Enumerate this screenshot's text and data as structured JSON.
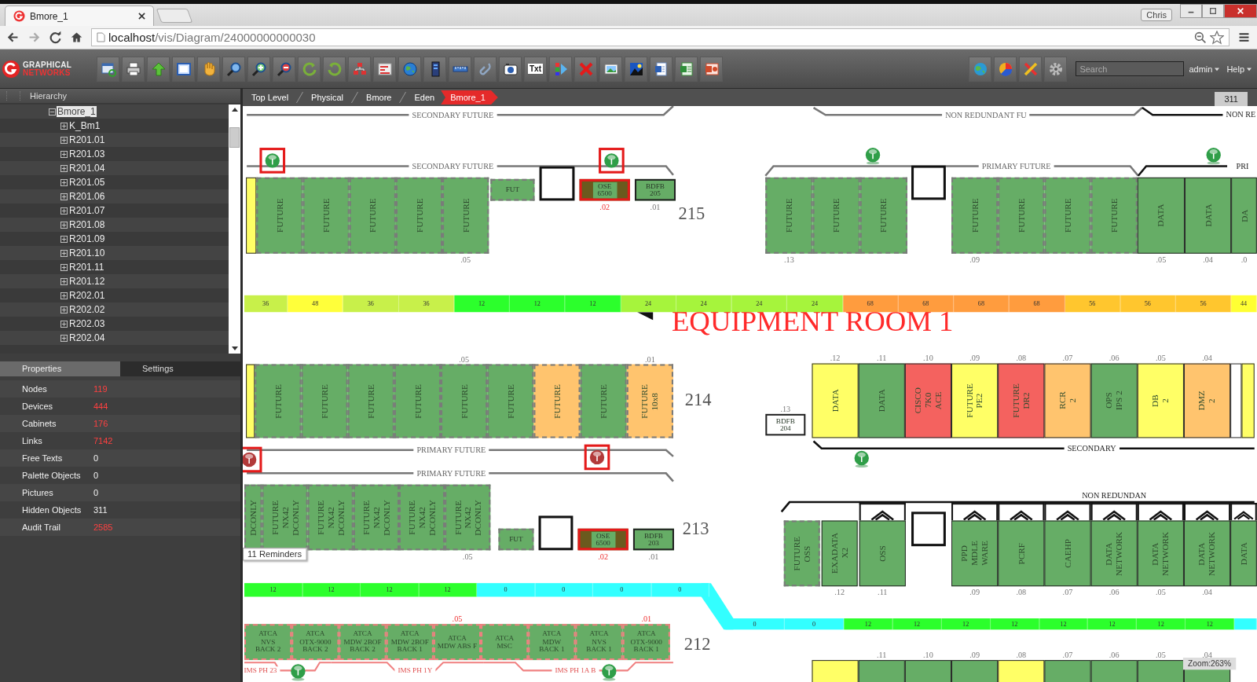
{
  "browser": {
    "tab_title": "Bmore_1",
    "profile": "Chris",
    "url_host": "localhost",
    "url_path": "/vis/Diagram/24000000000030"
  },
  "toolbar": {
    "logo_top": "GRAPHICAL",
    "logo_bottom": "NETWORKS",
    "text_tool": "Txt",
    "search": {
      "placeholder": "Search"
    },
    "menus": [
      "admin",
      "Help"
    ]
  },
  "hierarchy": {
    "title": "Hierarchy",
    "tree": [
      {
        "label": "Bmore_1",
        "expanded": true,
        "selected": true,
        "children": [
          {
            "label": "K_Bm1",
            "expanded": false,
            "selected": false
          },
          {
            "label": "R201.01",
            "expanded": false,
            "selected": false
          },
          {
            "label": "R201.03",
            "expanded": false,
            "selected": false
          },
          {
            "label": "R201.04",
            "expanded": false,
            "selected": false
          },
          {
            "label": "R201.05",
            "expanded": false,
            "selected": false
          },
          {
            "label": "R201.06",
            "expanded": false,
            "selected": false
          },
          {
            "label": "R201.07",
            "expanded": false,
            "selected": false
          },
          {
            "label": "R201.08",
            "expanded": false,
            "selected": false
          },
          {
            "label": "R201.09",
            "expanded": false,
            "selected": false
          },
          {
            "label": "R201.10",
            "expanded": false,
            "selected": false
          },
          {
            "label": "R201.11",
            "expanded": false,
            "selected": false
          },
          {
            "label": "R201.12",
            "expanded": false,
            "selected": false
          },
          {
            "label": "R202.01",
            "expanded": false,
            "selected": false
          },
          {
            "label": "R202.02",
            "expanded": false,
            "selected": false
          },
          {
            "label": "R202.03",
            "expanded": false,
            "selected": false
          },
          {
            "label": "R202.04",
            "expanded": false,
            "selected": false
          }
        ]
      }
    ]
  },
  "properties": {
    "tabs": [
      {
        "label": "Properties",
        "selected": true
      },
      {
        "label": "Settings",
        "selected": false
      }
    ],
    "rows": [
      {
        "label": "Nodes",
        "value": "119",
        "alert": true
      },
      {
        "label": "Devices",
        "value": "444",
        "alert": true
      },
      {
        "label": "Cabinets",
        "value": "176",
        "alert": true
      },
      {
        "label": "Links",
        "value": "7142",
        "alert": true
      },
      {
        "label": "Free Texts",
        "value": "0",
        "alert": false
      },
      {
        "label": "Palette Objects",
        "value": "0",
        "alert": false
      },
      {
        "label": "Pictures",
        "value": "0",
        "alert": false
      },
      {
        "label": "Hidden Objects",
        "value": "311",
        "alert": false
      },
      {
        "label": "Audit Trail",
        "value": "2585",
        "alert": true
      }
    ]
  },
  "breadcrumb": [
    {
      "label": "Top Level",
      "selected": false
    },
    {
      "label": "Physical",
      "selected": false
    },
    {
      "label": "Bmore",
      "selected": false
    },
    {
      "label": "Eden",
      "selected": false
    },
    {
      "label": "Bmore_1",
      "selected": true
    }
  ],
  "hidden_badge": "311",
  "canvas": {
    "groups": [
      {
        "kind": "standard",
        "items": [
          {
            "kind": "cabinet",
            "color": "#ffff66",
            "planned": false
          },
          {
            "kind": "cabinet",
            "lines": [
              "FUTURE"
            ],
            "color": "#66ad66",
            "planned": true
          },
          {
            "kind": "cabinet",
            "lines": [
              "FUTURE"
            ],
            "color": "#66ad66",
            "planned": true
          },
          {
            "kind": "cabinet",
            "lines": [
              "FUTURE"
            ],
            "color": "#66ad66",
            "planned": true
          },
          {
            "kind": "cabinet",
            "lines": [
              "FUTURE"
            ],
            "color": "#66ad66",
            "planned": true
          },
          {
            "kind": "cabinet",
            "lines": [
              "FUTURE"
            ],
            "color": "#66ad66",
            "planned": true,
            "number": {
              "text": ".05",
              "alert": false
            }
          }
        ]
      },
      {
        "kind": "standard",
        "items": [
          {
            "kind": "device",
            "lines": [
              "FUT"
            ],
            "color": "#66ad66",
            "planned": true,
            "alert": false
          },
          {
            "kind": "slot"
          },
          {
            "kind": "device",
            "lines": [
              "OSE",
              "6500"
            ],
            "color": "#66ad66",
            "planned": false,
            "alert": true,
            "number": {
              "text": ".02",
              "alert": true
            }
          },
          {
            "kind": "device",
            "lines": [
              "BDFB",
              "205"
            ],
            "color": "#66ad66",
            "planned": false,
            "alert": false,
            "number": {
              "text": ".01",
              "alert": false
            }
          }
        ]
      },
      {
        "kind": "standard",
        "items": [
          {
            "kind": "cabinet",
            "lines": [
              "FUTURE"
            ],
            "color": "#66ad66",
            "planned": true,
            "number": {
              "text": ".13",
              "alert": false
            }
          },
          {
            "kind": "cabinet",
            "lines": [
              "FUTURE"
            ],
            "color": "#66ad66",
            "planned": true
          },
          {
            "kind": "cabinet",
            "lines": [
              "FUTURE"
            ],
            "color": "#66ad66",
            "planned": true
          }
        ]
      },
      {
        "kind": "standard",
        "items": [
          {
            "kind": "slot"
          }
        ]
      },
      {
        "kind": "standard",
        "items": [
          {
            "kind": "cabinet",
            "lines": [
              "FUTURE"
            ],
            "color": "#66ad66",
            "planned": true,
            "number": {
              "text": ".09",
              "alert": false
            }
          },
          {
            "kind": "cabinet",
            "lines": [
              "FUTURE"
            ],
            "color": "#66ad66",
            "planned": true
          },
          {
            "kind": "cabinet",
            "lines": [
              "FUTURE"
            ],
            "color": "#66ad66",
            "planned": true
          },
          {
            "kind": "cabinet",
            "lines": [
              "FUTURE"
            ],
            "color": "#66ad66",
            "planned": true
          },
          {
            "kind": "cabinet",
            "lines": [
              "DATA"
            ],
            "color": "#66ad66",
            "planned": false,
            "number": {
              "text": ".05",
              "alert": false
            }
          },
          {
            "kind": "cabinet",
            "lines": [
              "DATA"
            ],
            "color": "#66ad66",
            "planned": false,
            "number": {
              "text": ".04",
              "alert": false
            }
          },
          {
            "kind": "cabinet",
            "lines": [
              "DA"
            ],
            "color": "#66ad66",
            "planned": false,
            "number": {
              "text": ".0",
              "alert": false
            }
          }
        ]
      },
      {
        "kind": "standard",
        "items": [
          {
            "kind": "cabinet",
            "color": "#ffff66",
            "planned": false
          },
          {
            "kind": "cabinet",
            "lines": [
              "FUTURE"
            ],
            "color": "#66ad66",
            "planned": true
          },
          {
            "kind": "cabinet",
            "lines": [
              "FUTURE"
            ],
            "color": "#66ad66",
            "planned": true
          },
          {
            "kind": "cabinet",
            "lines": [
              "FUTURE"
            ],
            "color": "#66ad66",
            "planned": true
          },
          {
            "kind": "cabinet",
            "lines": [
              "FUTURE"
            ],
            "color": "#66ad66",
            "planned": true
          },
          {
            "kind": "cabinet",
            "lines": [
              "FUTURE"
            ],
            "color": "#66ad66",
            "planned": true,
            "number": {
              "text": ".05",
              "alert": false
            }
          },
          {
            "kind": "cabinet",
            "lines": [
              "FUTURE"
            ],
            "color": "#66ad66",
            "planned": true
          },
          {
            "kind": "cabinet",
            "lines": [
              "FUTURE"
            ],
            "color": "#ffc46e",
            "planned": true
          },
          {
            "kind": "cabinet",
            "lines": [
              "FUTURE"
            ],
            "color": "#66ad66",
            "planned": true
          },
          {
            "kind": "cabinet",
            "lines": [
              "FUTURE",
              "10x8"
            ],
            "color": "#ffc46e",
            "planned": true,
            "number": {
              "text": ".01",
              "alert": false
            }
          }
        ]
      },
      {
        "kind": "standard",
        "items": [
          {
            "kind": "device",
            "lines": [
              "BDFB",
              "204"
            ],
            "color": "#ffffff",
            "planned": false,
            "alert": false,
            "number": {
              "text": ".13",
              "alert": false
            }
          }
        ]
      },
      {
        "kind": "standard",
        "items": [
          {
            "kind": "cabinet",
            "lines": [
              "DATA"
            ],
            "color": "#ffff66",
            "planned": false,
            "number": {
              "text": ".12",
              "alert": false
            }
          },
          {
            "kind": "cabinet",
            "lines": [
              "DATA"
            ],
            "color": "#66ad66",
            "planned": false,
            "number": {
              "text": ".11",
              "alert": false
            }
          },
          {
            "kind": "cabinet",
            "lines": [
              "CISCO",
              "7K0",
              "ACE"
            ],
            "color": "#f4625f",
            "planned": false,
            "number": {
              "text": ".10",
              "alert": false
            }
          },
          {
            "kind": "cabinet",
            "lines": [
              "FUTURE",
              "PE2"
            ],
            "color": "#ffff66",
            "planned": false,
            "number": {
              "text": ".09",
              "alert": false
            }
          },
          {
            "kind": "cabinet",
            "lines": [
              "FUTURE",
              "DR2"
            ],
            "color": "#f4625f",
            "planned": false,
            "number": {
              "text": ".08",
              "alert": false
            }
          },
          {
            "kind": "cabinet",
            "lines": [
              "RCR",
              "2"
            ],
            "color": "#ffc46e",
            "planned": false,
            "number": {
              "text": ".07",
              "alert": false
            }
          },
          {
            "kind": "cabinet",
            "lines": [
              "OPS",
              "IPS 2"
            ],
            "color": "#66ad66",
            "planned": false,
            "number": {
              "text": ".06",
              "alert": false
            }
          },
          {
            "kind": "cabinet",
            "lines": [
              "DB",
              "2"
            ],
            "color": "#ffff66",
            "planned": false,
            "number": {
              "text": ".05",
              "alert": false
            }
          },
          {
            "kind": "cabinet",
            "lines": [
              "DMZ",
              "2"
            ],
            "color": "#ffc46e",
            "planned": false,
            "number": {
              "text": ".04",
              "alert": false
            }
          },
          {
            "kind": "cabinet",
            "color": "#ffffff",
            "planned": false
          },
          {
            "kind": "cabinet",
            "color": "#ffff66",
            "planned": false
          }
        ]
      },
      {
        "kind": "standard",
        "items": [
          {
            "kind": "cabinet",
            "lines": [
              "DCONLY"
            ],
            "color": "#66ad66",
            "planned": true
          },
          {
            "kind": "cabinet",
            "lines": [
              "FUTURE",
              "NX42",
              "DCONLY"
            ],
            "color": "#66ad66",
            "planned": true
          },
          {
            "kind": "cabinet",
            "lines": [
              "FUTURE",
              "NX42",
              "DCONLY"
            ],
            "color": "#66ad66",
            "planned": true
          },
          {
            "kind": "cabinet",
            "lines": [
              "FUTURE",
              "NX42",
              "DCONLY"
            ],
            "color": "#66ad66",
            "planned": true
          },
          {
            "kind": "cabinet",
            "lines": [
              "FUTURE",
              "NX42",
              "DCONLY"
            ],
            "color": "#66ad66",
            "planned": true
          },
          {
            "kind": "cabinet",
            "lines": [
              "FUTURE",
              "NX42",
              "DCONLY"
            ],
            "color": "#66ad66",
            "planned": true,
            "number": {
              "text": ".05",
              "alert": false
            }
          }
        ]
      },
      {
        "kind": "standard",
        "items": [
          {
            "kind": "device",
            "lines": [
              "FUT"
            ],
            "color": "#66ad66",
            "planned": true,
            "alert": false
          },
          {
            "kind": "slot"
          },
          {
            "kind": "device",
            "lines": [
              "OSE",
              "6500"
            ],
            "color": "#66ad66",
            "planned": false,
            "alert": true,
            "number": {
              "text": ".02",
              "alert": true
            }
          },
          {
            "kind": "device",
            "lines": [
              "BDFB",
              "203"
            ],
            "color": "#66ad66",
            "planned": false,
            "alert": false,
            "number": {
              "text": ".01",
              "alert": false
            }
          }
        ]
      },
      {
        "kind": "standard",
        "items": [
          {
            "kind": "cabinet",
            "lines": [
              "FUTURE",
              "OSS"
            ],
            "color": "#66ad66",
            "planned": true,
            "hooded": false
          },
          {
            "kind": "cabinet",
            "lines": [
              "EXADATA",
              "X2"
            ],
            "color": "#66ad66",
            "planned": false,
            "hooded": false,
            "number": {
              "text": ".12",
              "alert": false
            }
          },
          {
            "kind": "cabinet",
            "lines": [
              "OSS"
            ],
            "color": "#66ad66",
            "planned": false,
            "hooded": true,
            "number": {
              "text": ".11",
              "alert": false
            }
          }
        ]
      },
      {
        "kind": "standard",
        "items": [
          {
            "kind": "slot"
          }
        ]
      },
      {
        "kind": "standard",
        "items": [
          {
            "kind": "cabinet",
            "lines": [
              "PPD",
              "MDLE",
              "WARE"
            ],
            "color": "#66ad66",
            "planned": false,
            "hooded": true,
            "number": {
              "text": ".09",
              "alert": false
            }
          },
          {
            "kind": "cabinet",
            "lines": [
              "PCRF"
            ],
            "color": "#66ad66",
            "planned": false,
            "hooded": true,
            "number": {
              "text": ".08",
              "alert": false
            }
          },
          {
            "kind": "cabinet",
            "lines": [
              "CAEHP"
            ],
            "color": "#66ad66",
            "planned": false,
            "hooded": true,
            "number": {
              "text": ".07",
              "alert": false
            }
          },
          {
            "kind": "cabinet",
            "lines": [
              "DATA",
              "NETWORK"
            ],
            "color": "#66ad66",
            "planned": false,
            "hooded": true,
            "number": {
              "text": ".06",
              "alert": false
            }
          },
          {
            "kind": "cabinet",
            "lines": [
              "DATA",
              "NETWORK"
            ],
            "color": "#66ad66",
            "planned": false,
            "hooded": true,
            "number": {
              "text": ".05",
              "alert": false
            }
          },
          {
            "kind": "cabinet",
            "lines": [
              "DATA",
              "NETWORK"
            ],
            "color": "#66ad66",
            "planned": false,
            "hooded": true,
            "number": {
              "text": ".04",
              "alert": false
            }
          },
          {
            "kind": "cabinet",
            "lines": [
              "DATA"
            ],
            "color": "#66ad66",
            "planned": false,
            "hooded": true
          }
        ]
      },
      {
        "kind": "ims",
        "items": [
          {
            "kind": "cabinet",
            "lines": [
              "ATCA",
              "NVS",
              "BACK 2"
            ],
            "color": "#66ad66",
            "planned": true
          },
          {
            "kind": "cabinet",
            "lines": [
              "ATCA",
              "OTX-9000",
              "BACK 2"
            ],
            "color": "#66ad66",
            "planned": true
          },
          {
            "kind": "cabinet",
            "lines": [
              "ATCA",
              "MDW 2BOF",
              "BACK 2"
            ],
            "color": "#66ad66",
            "planned": true
          },
          {
            "kind": "cabinet",
            "lines": [
              "ATCA",
              "MDW 2BOF",
              "BACK 1"
            ],
            "color": "#66ad66",
            "planned": true
          },
          {
            "kind": "cabinet",
            "lines": [
              "ATCA",
              "MDW ABS F"
            ],
            "color": "#66ad66",
            "planned": true,
            "number": {
              "text": ".05",
              "alert": true
            }
          },
          {
            "kind": "cabinet",
            "lines": [
              "ATCA",
              "MSC"
            ],
            "color": "#66ad66",
            "planned": true
          },
          {
            "kind": "cabinet",
            "lines": [
              "ATCA",
              "MDW",
              "BACK 1"
            ],
            "color": "#66ad66",
            "planned": true
          },
          {
            "kind": "cabinet",
            "lines": [
              "ATCA",
              "NVS",
              "BACK 1"
            ],
            "color": "#66ad66",
            "planned": true
          },
          {
            "kind": "cabinet",
            "lines": [
              "ATCA",
              "OTX-9000",
              "BACK 1"
            ],
            "color": "#66ad66",
            "planned": true,
            "number": {
              "text": ".01",
              "alert": true
            }
          }
        ]
      },
      {
        "kind": "standard",
        "items": [
          {
            "kind": "cabinet",
            "color": "#ffff66",
            "planned": false
          },
          {
            "kind": "cabinet",
            "color": "#66ad66",
            "planned": false,
            "number": {
              "text": ".11",
              "alert": false
            }
          },
          {
            "kind": "cabinet",
            "color": "#66ad66",
            "planned": false,
            "number": {
              "text": ".10",
              "alert": false
            }
          },
          {
            "kind": "cabinet",
            "color": "#66ad66",
            "planned": false,
            "number": {
              "text": ".09",
              "alert": false
            }
          },
          {
            "kind": "cabinet",
            "color": "#ffff66",
            "planned": false,
            "number": {
              "text": ".08",
              "alert": false
            }
          },
          {
            "kind": "cabinet",
            "color": "#66ad66",
            "planned": false,
            "number": {
              "text": ".07",
              "alert": false
            }
          },
          {
            "kind": "cabinet",
            "color": "#66ad66",
            "planned": false,
            "number": {
              "text": ".06",
              "alert": false
            }
          },
          {
            "kind": "cabinet",
            "color": "#66ad66",
            "planned": false,
            "number": {
              "text": ".05",
              "alert": false
            }
          },
          {
            "kind": "cabinet",
            "color": "#66ad66",
            "planned": false,
            "number": {
              "text": ".04",
              "alert": false
            }
          }
        ]
      }
    ],
    "buses": [
      {
        "label": "SECONDARY FUTURE",
        "kind": "future"
      },
      {
        "label": "NON REDUNDANT FU",
        "kind": "future"
      },
      {
        "label": "NON RE",
        "kind": "live"
      },
      {
        "label": "SECONDARY FUTURE",
        "kind": "future"
      },
      {
        "label": "PRIMARY FUTURE",
        "kind": "future"
      },
      {
        "label": "PRI",
        "kind": "live"
      },
      {
        "label": "PRIMARY FUTURE",
        "kind": "future"
      },
      {
        "label": "PRIMARY FUTURE",
        "kind": "future"
      },
      {
        "label": "SECONDARY",
        "kind": "live"
      },
      {
        "label": "NON REDUNDAN",
        "kind": "live"
      },
      {
        "label": "IMS PH 23",
        "kind": "ims"
      },
      {
        "label": "IMS PH 1Y",
        "kind": "ims"
      },
      {
        "label": "IMS PH 1A B",
        "kind": "ims"
      }
    ],
    "markers": [
      {
        "color": "#2f9e48",
        "framed": true
      },
      {
        "color": "#2f9e48",
        "framed": true
      },
      {
        "color": "#2f9e48",
        "framed": false
      },
      {
        "color": "#2f9e48",
        "framed": false
      },
      {
        "color": "#b23a3a",
        "framed": true
      },
      {
        "color": "#b23a3a",
        "framed": true
      },
      {
        "color": "#2f9e48",
        "framed": false
      },
      {
        "color": "#2f9e48",
        "framed": false
      },
      {
        "color": "#2f9e48",
        "framed": false
      }
    ],
    "power_strips": [
      {
        "segments": [
          {
            "reading": "36",
            "color": "#c8f04a"
          },
          {
            "reading": "48",
            "color": "#ffff3a"
          },
          {
            "reading": "36",
            "color": "#c8f04a"
          },
          {
            "reading": "36",
            "color": "#c8f04a"
          },
          {
            "reading": "12",
            "color": "#2cff2c"
          },
          {
            "reading": "12",
            "color": "#2cff2c"
          },
          {
            "reading": "12",
            "color": "#2cff2c"
          },
          {
            "reading": "24",
            "color": "#a6f43c"
          },
          {
            "reading": "24",
            "color": "#a6f43c"
          },
          {
            "reading": "24",
            "color": "#a6f43c"
          },
          {
            "reading": "24",
            "color": "#a6f43c"
          },
          {
            "reading": "68",
            "color": "#ff9c3e"
          },
          {
            "reading": "68",
            "color": "#ff9c3e"
          },
          {
            "reading": "68",
            "color": "#ff9c3e"
          },
          {
            "reading": "68",
            "color": "#ff9c3e"
          },
          {
            "reading": "56",
            "color": "#ffc62e"
          },
          {
            "reading": "56",
            "color": "#ffc62e"
          },
          {
            "reading": "56",
            "color": "#ffc62e"
          },
          {
            "reading": "44",
            "color": "#ffff33"
          }
        ]
      },
      {
        "segments": [
          {
            "reading": "12",
            "color": "#2cff2c"
          },
          {
            "reading": "12",
            "color": "#2cff2c"
          },
          {
            "reading": "12",
            "color": "#2cff2c"
          },
          {
            "reading": "12",
            "color": "#2cff2c"
          },
          {
            "reading": "0",
            "color": "#33ffff"
          },
          {
            "reading": "0",
            "color": "#33ffff"
          },
          {
            "reading": "0",
            "color": "#33ffff"
          },
          {
            "reading": "0",
            "color": "#33ffff"
          }
        ]
      },
      {
        "segments": [
          {
            "reading": "0",
            "color": "#33ffff"
          },
          {
            "reading": "0",
            "color": "#33ffff"
          },
          {
            "reading": "12",
            "color": "#2cff2c"
          },
          {
            "reading": "12",
            "color": "#2cff2c"
          },
          {
            "reading": "12",
            "color": "#2cff2c"
          },
          {
            "reading": "12",
            "color": "#2cff2c"
          },
          {
            "reading": "12",
            "color": "#2cff2c"
          },
          {
            "reading": "12",
            "color": "#2cff2c"
          },
          {
            "reading": "12",
            "color": "#2cff2c"
          },
          {
            "reading": "12",
            "color": "#2cff2c"
          },
          {
            "color": "#33ffff"
          }
        ]
      }
    ],
    "row_numbers": [
      "215",
      "214",
      "213",
      "212"
    ],
    "room_label": "EQUIPMENT ROOM 1",
    "reminders": "11 Reminders",
    "zoom": "Zoom:263%"
  }
}
